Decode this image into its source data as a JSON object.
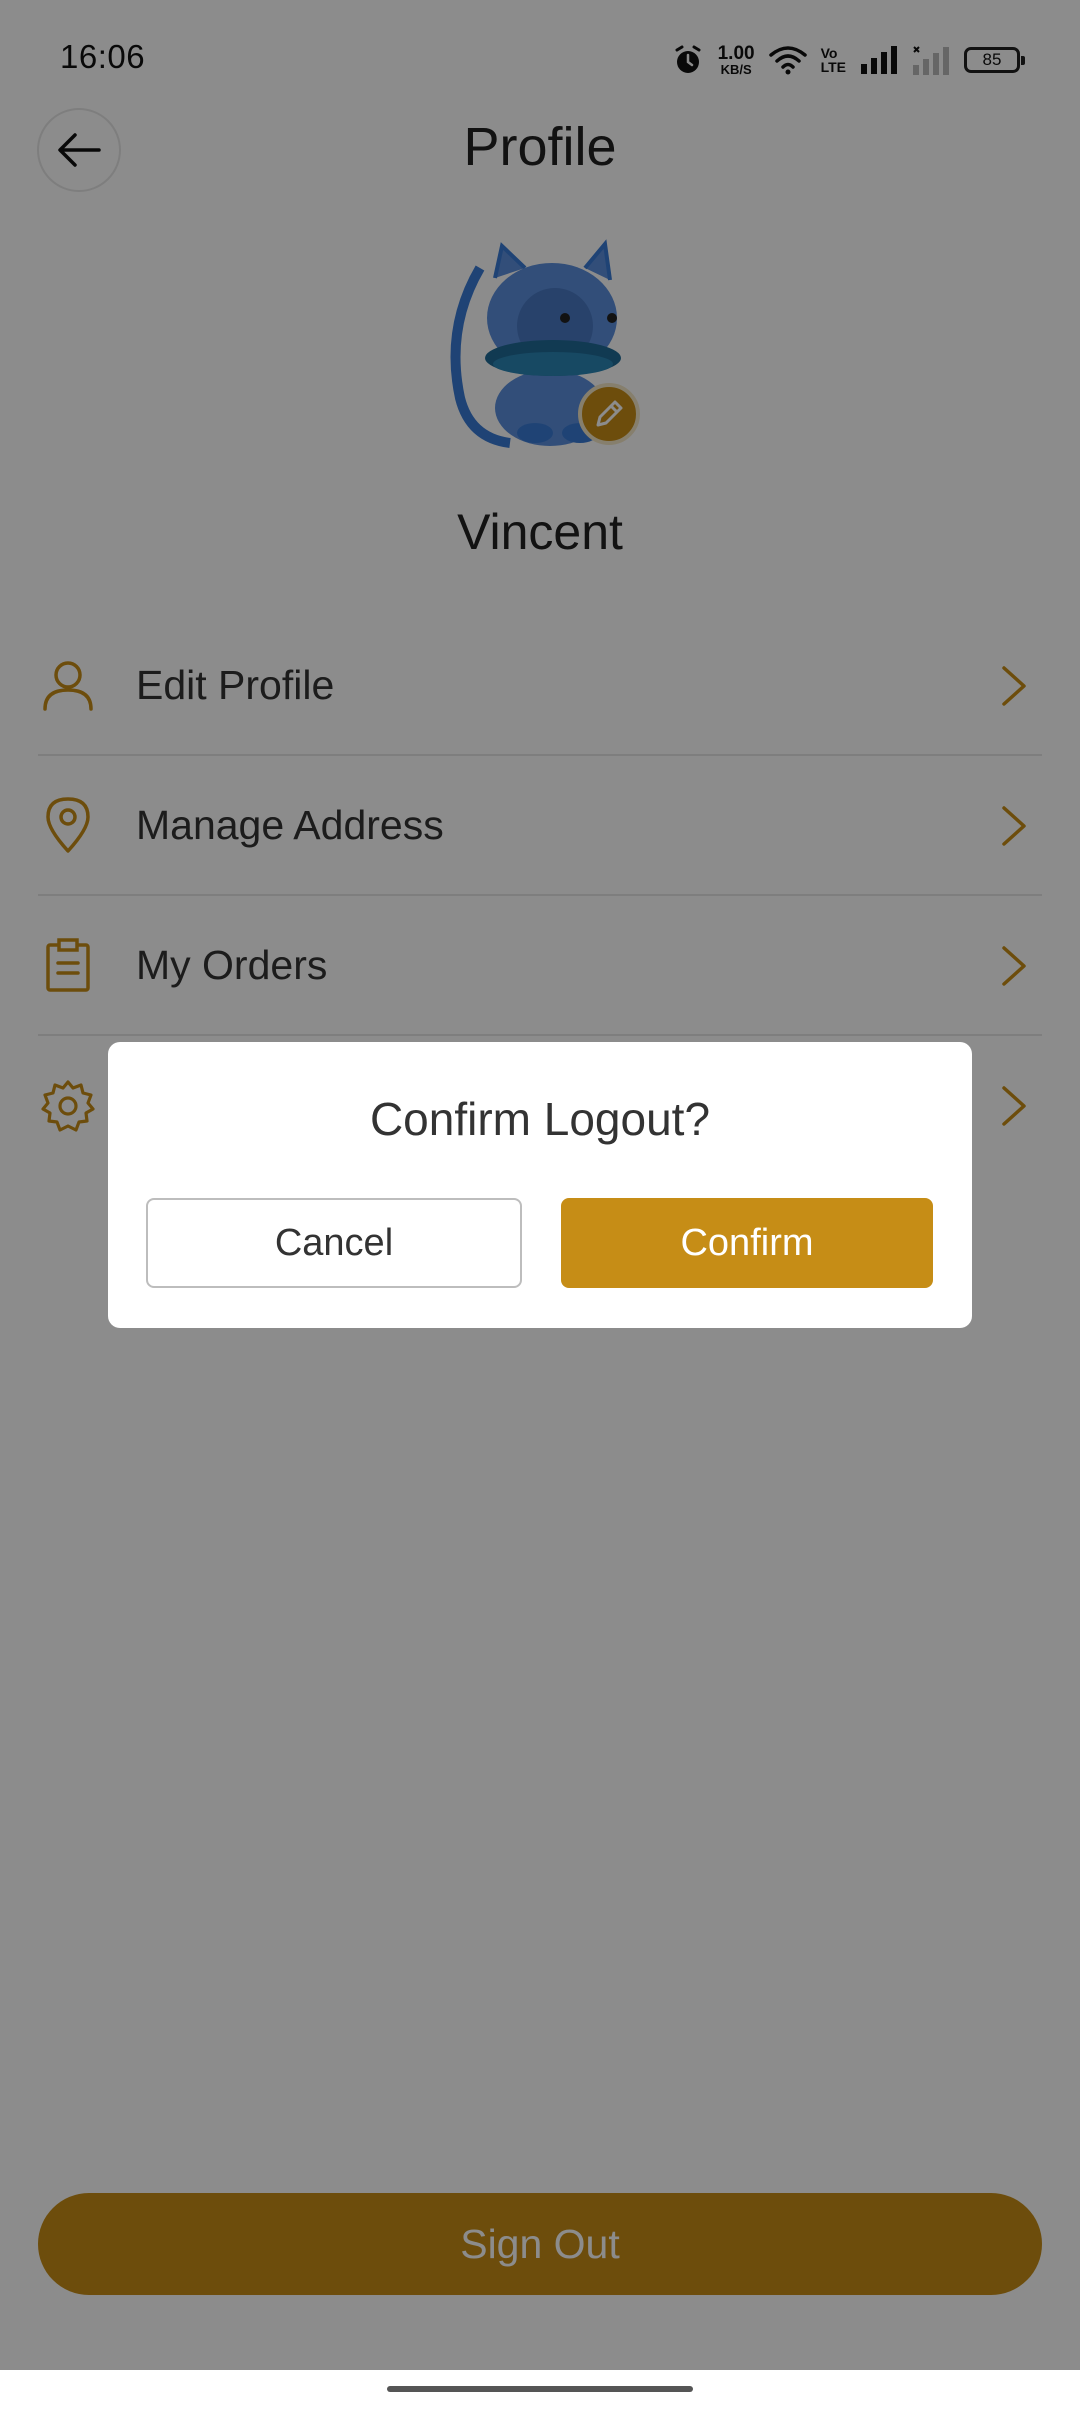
{
  "status_bar": {
    "time": "16:06",
    "net_speed_value": "1.00",
    "net_speed_unit": "KB/S",
    "volte_top": "Vo",
    "volte_bottom": "LTE",
    "battery": "85",
    "icons": [
      "alarm-icon",
      "wifi-icon",
      "volte-icon",
      "signal-icon",
      "signal-no-service-icon",
      "battery-icon"
    ]
  },
  "header": {
    "title": "Profile",
    "back_icon": "arrow-left-icon"
  },
  "profile": {
    "name": "Vincent",
    "edit_icon": "pencil-icon"
  },
  "menu": {
    "items": [
      {
        "label": "Edit Profile",
        "icon": "user-icon"
      },
      {
        "label": "Manage Address",
        "icon": "location-pin-icon"
      },
      {
        "label": "My Orders",
        "icon": "clipboard-icon"
      },
      {
        "label": "",
        "icon": "gear-icon"
      }
    ]
  },
  "signout": {
    "label": "Sign Out"
  },
  "dialog": {
    "title": "Confirm Logout?",
    "cancel_label": "Cancel",
    "confirm_label": "Confirm"
  },
  "colors": {
    "accent": "#c68d16",
    "overlay": "rgba(0,0,0,0.45)"
  }
}
